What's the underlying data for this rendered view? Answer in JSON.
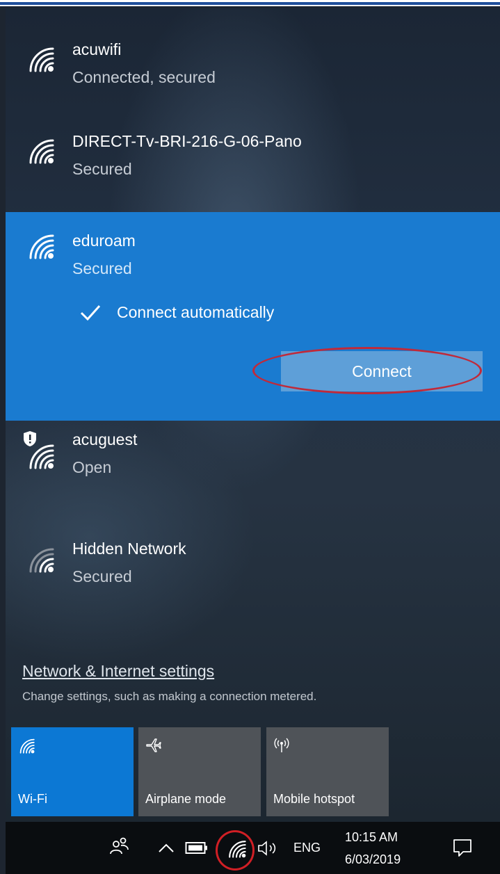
{
  "networks": [
    {
      "name": "acuwifi",
      "status": "Connected, secured",
      "icon": "wifi-icon"
    },
    {
      "name": "DIRECT-Tv-BRI-216-G-06-Pano",
      "status": "Secured",
      "icon": "wifi-icon"
    },
    {
      "name": "eduroam",
      "status": "Secured",
      "icon": "wifi-icon",
      "selected": true,
      "connect_automatically": "Connect automatically",
      "connect_button": "Connect"
    },
    {
      "name": "acuguest",
      "status": "Open",
      "icon": "wifi-shield-icon"
    },
    {
      "name": "Hidden Network",
      "status": "Secured",
      "icon": "wifi-icon"
    }
  ],
  "settings": {
    "link": "Network & Internet settings",
    "description": "Change settings, such as making a connection metered."
  },
  "quick_actions": [
    {
      "label": "Wi-Fi",
      "icon": "wifi-icon",
      "active": true
    },
    {
      "label": "Airplane mode",
      "icon": "airplane-icon",
      "active": false
    },
    {
      "label": "Mobile hotspot",
      "icon": "hotspot-icon",
      "active": false
    }
  ],
  "taskbar": {
    "language": "ENG",
    "time": "10:15 AM",
    "date": "6/03/2019"
  },
  "colors": {
    "accent": "#1a7bd0",
    "tile_active": "#0c78d4",
    "highlight_ring": "#c02a3a"
  }
}
